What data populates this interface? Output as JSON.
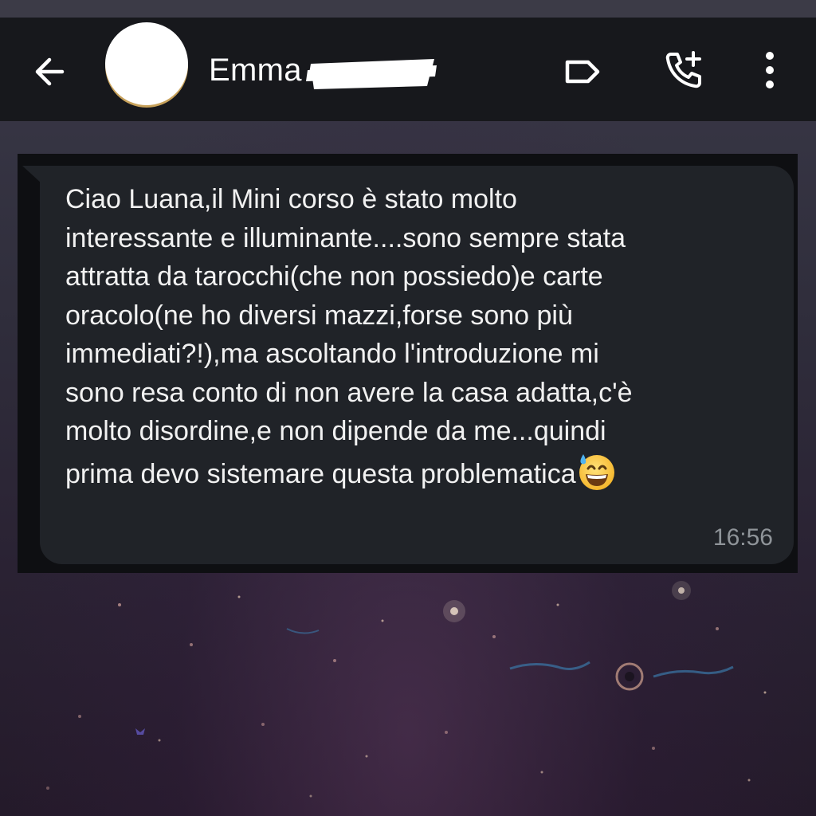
{
  "header": {
    "contact_name": "Emma",
    "back_icon": "arrow-left-icon",
    "label_icon": "label-tag-icon",
    "call_icon": "add-call-icon",
    "more_icon": "more-vertical-icon"
  },
  "message": {
    "text": "Ciao Luana,il Mini corso è stato molto\ninteressante e illuminante....sono sempre stata\nattratta da tarocchi(che non possiedo)e carte\noracolo(ne ho diversi mazzi,forse sono più\nimmediati?!),ma ascoltando l'introduzione mi\nsono resa conto di non avere la casa adatta,c'è\nmolto disordine,e non dipende da me...quindi\nprima devo sistemare questa problematica",
    "emoji_icon": "grinning-sweat-emoji-icon",
    "time": "16:56"
  },
  "colors": {
    "header_bg": "#17181c",
    "bubble_bg": "#202328",
    "text": "#f1f1f1",
    "timestamp": "#8f9499"
  }
}
